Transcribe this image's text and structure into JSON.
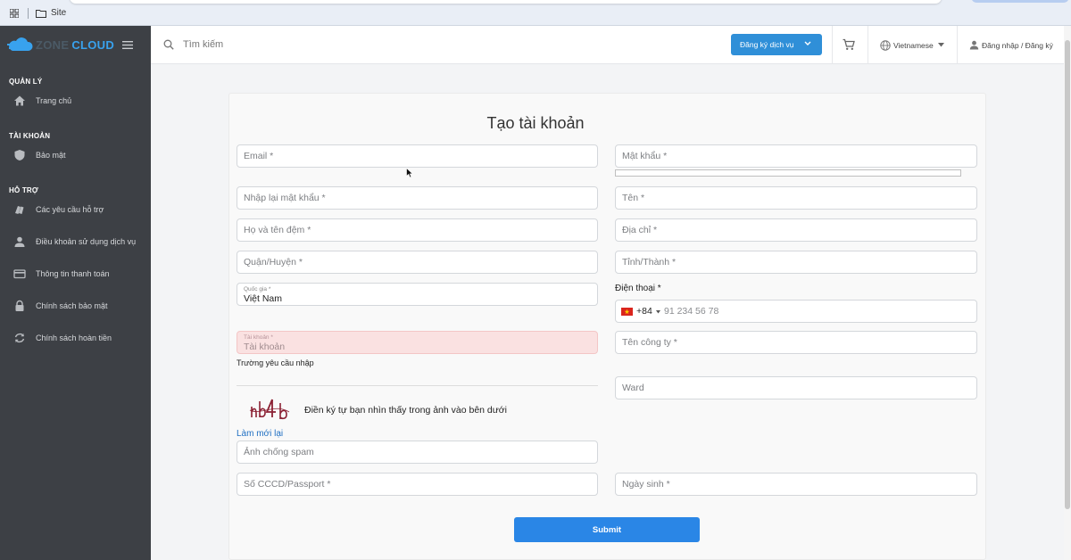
{
  "browser": {
    "breadcrumb": "Site"
  },
  "sidebar": {
    "brand": {
      "part1": "ZONE",
      "part2": "CLOUD"
    },
    "sections": [
      {
        "title": "QUẢN LÝ",
        "items": [
          {
            "label": "Trang chủ",
            "icon": "home-icon"
          }
        ]
      },
      {
        "title": "TÀI KHOẢN",
        "items": [
          {
            "label": "Bảo mật",
            "icon": "shield-icon"
          }
        ]
      },
      {
        "title": "HỖ TRỢ",
        "items": [
          {
            "label": "Các yêu cầu hỗ trợ",
            "icon": "tickets-icon"
          },
          {
            "label": "Điều khoản sử dụng dịch vụ",
            "icon": "person-icon"
          },
          {
            "label": "Thông tin thanh toán",
            "icon": "credit-card-icon"
          },
          {
            "label": "Chính sách bảo mật",
            "icon": "lock-icon"
          },
          {
            "label": "Chính sách hoàn tiền",
            "icon": "refresh-icon"
          }
        ]
      }
    ]
  },
  "header": {
    "search_placeholder": "Tìm kiếm",
    "register_service": "Đăng ký dịch vụ",
    "language": "Vietnamese",
    "login": "Đăng nhập / Đăng ký"
  },
  "form": {
    "title": "Tạo tài khoản",
    "fields": {
      "email": "Email *",
      "password": "Mật khẩu *",
      "confirm_password": "Nhập lại mật khẩu *",
      "first_name": "Tên *",
      "last_name": "Họ và tên đệm *",
      "address": "Địa chỉ *",
      "district": "Quận/Huyện *",
      "province": "Tỉnh/Thành *",
      "country_label": "Quốc gia *",
      "country_value": "Việt Nam",
      "phone_label": "Điện thoại *",
      "phone_code": "+84",
      "phone_placeholder": "91 234 56 78",
      "username_label": "Tài khoản *",
      "username_placeholder": "Tài khoản",
      "username_error": "Trường yêu cầu nhập",
      "company": "Tên công ty *",
      "ward": "Ward",
      "captcha_instruction": "Điền ký tự bạn nhìn thấy trong ảnh vào bên dưới",
      "captcha_refresh": "Làm mới lại",
      "captcha_input": "Ảnh chống spam",
      "id_number": "Số CCCD/Passport *",
      "birthday": "Ngày sinh *"
    },
    "submit": "Submit"
  },
  "colors": {
    "sidebar_bg": "#3d4045",
    "primary": "#2a86e6",
    "error_bg": "#fae1e1",
    "brand_blue": "#38a2ee"
  }
}
